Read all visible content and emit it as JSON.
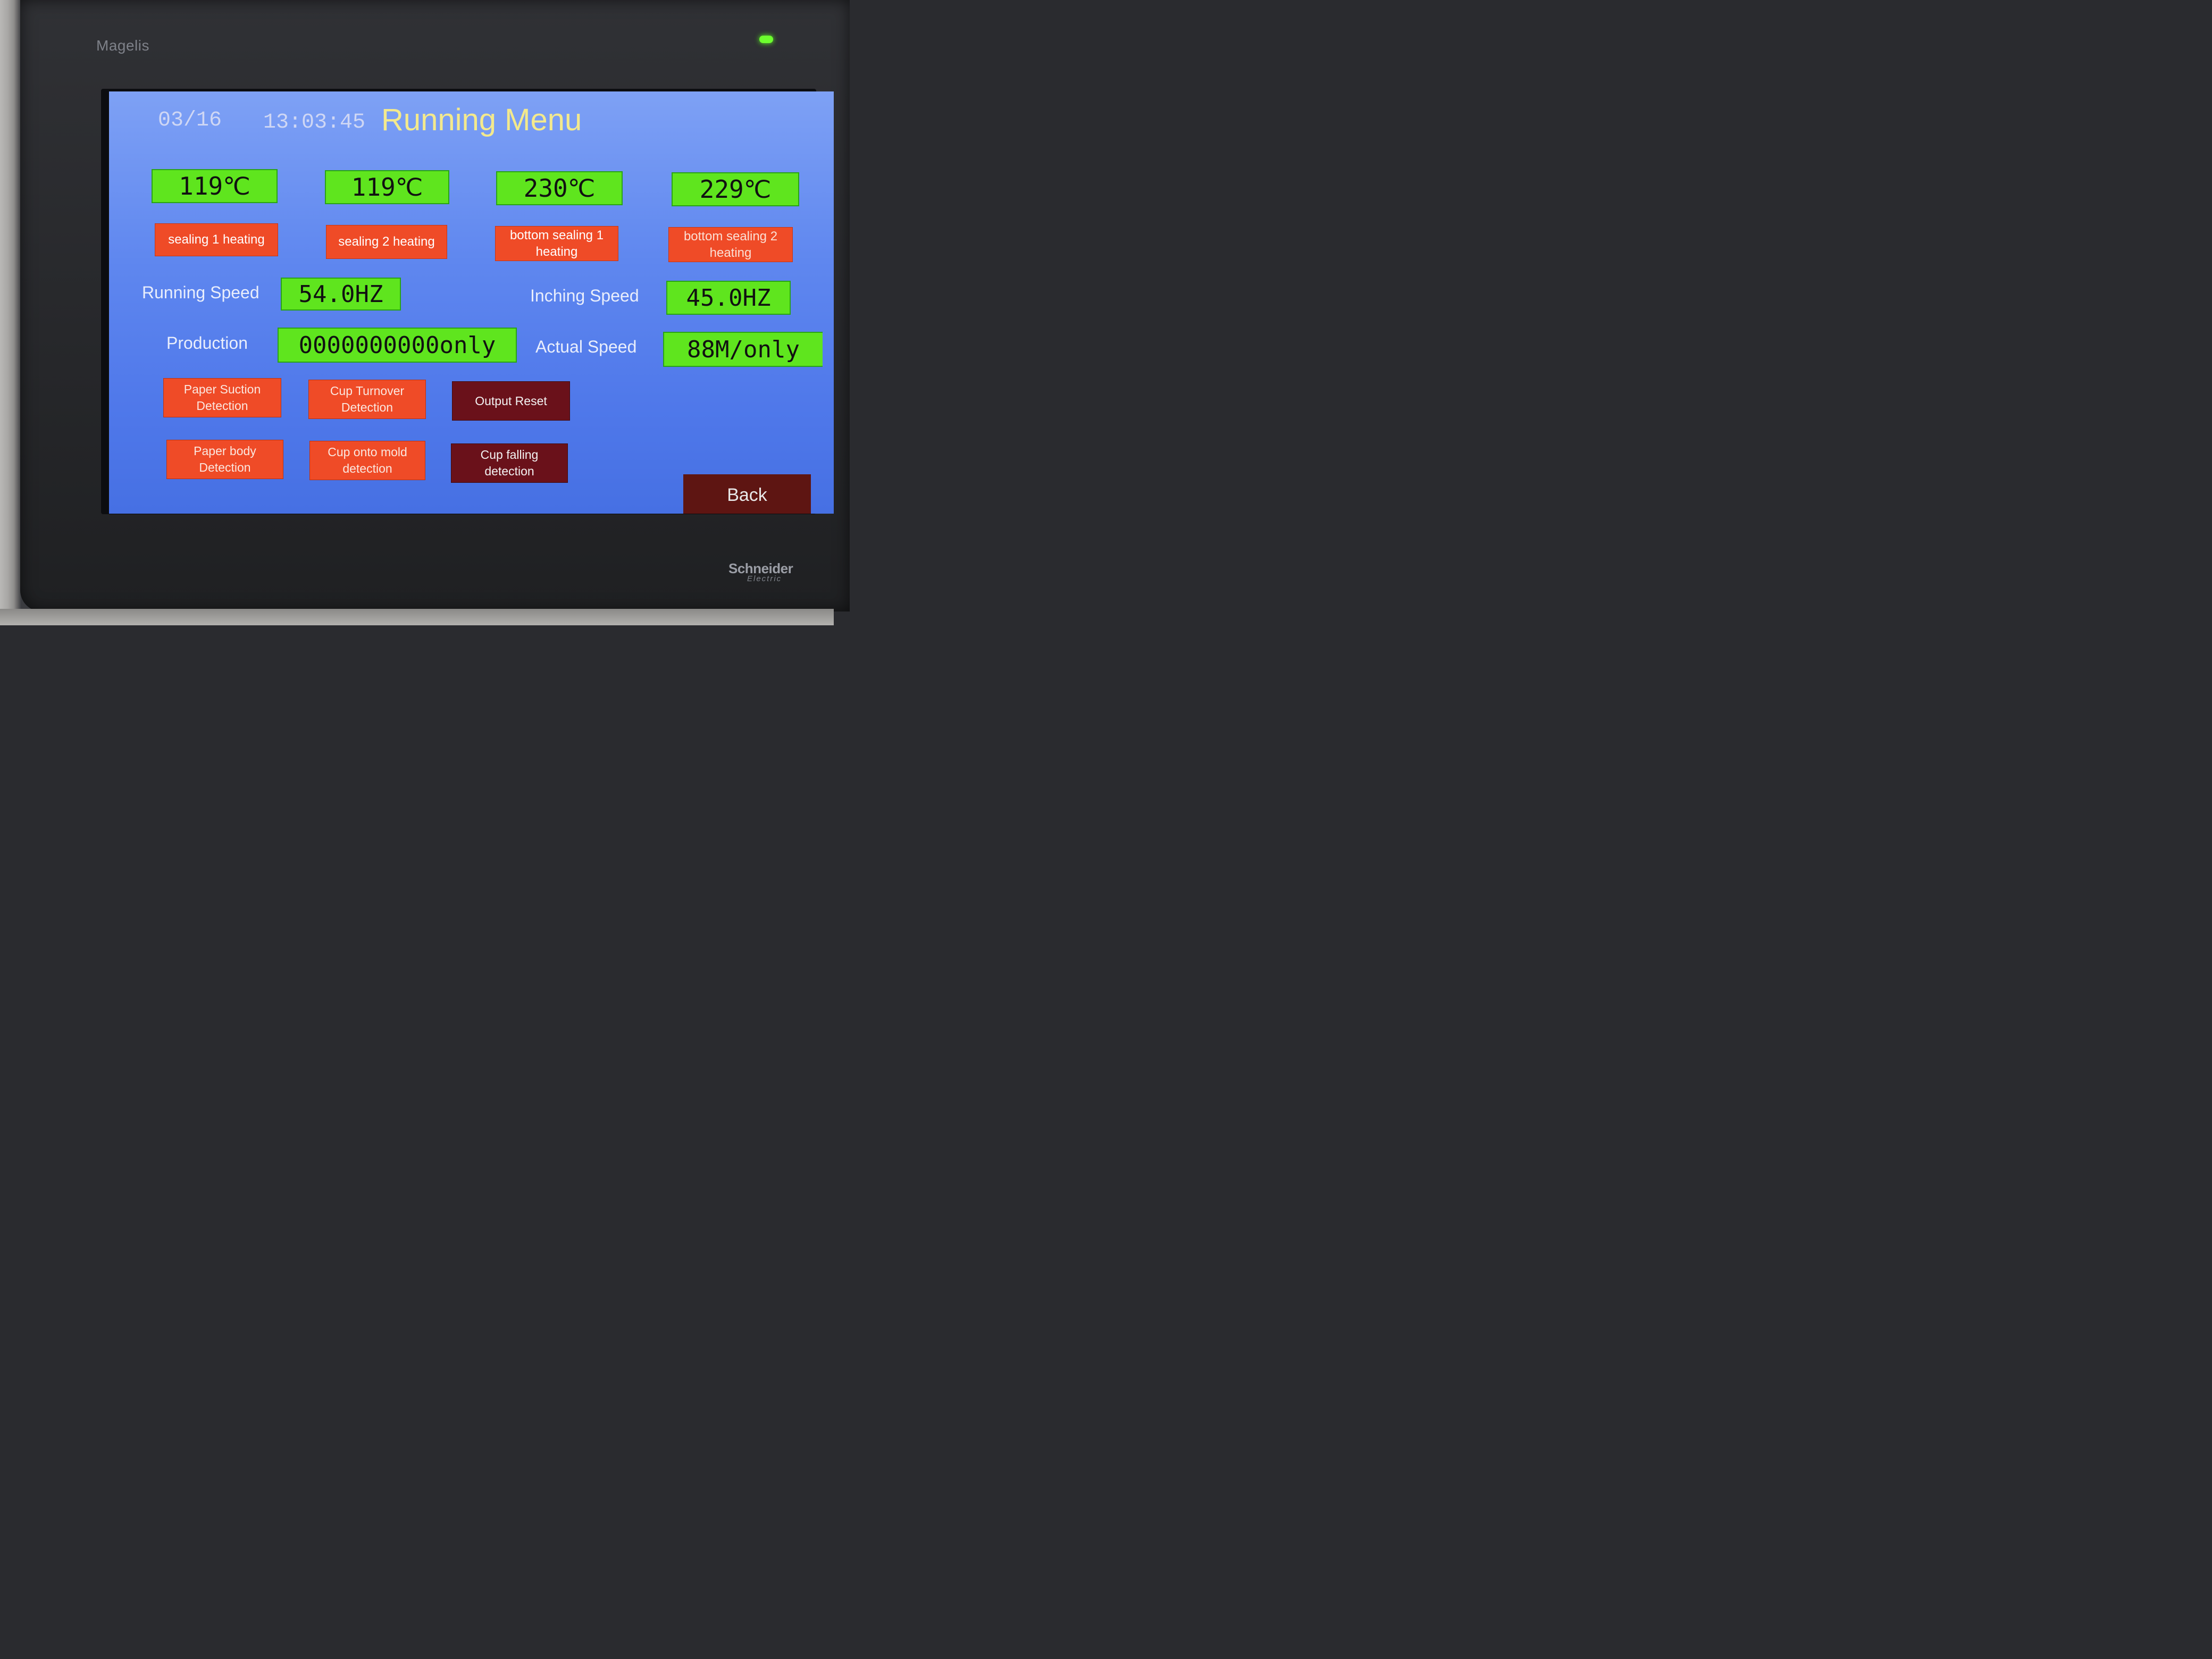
{
  "device": {
    "brand": "Magelis",
    "maker": "Schneider",
    "maker_sub": "Electric"
  },
  "header": {
    "date": "03/16",
    "time": "13:03:45",
    "title": "Running Menu"
  },
  "temperatures": [
    {
      "value": "119℃",
      "label": "sealing 1 heating"
    },
    {
      "value": "119℃",
      "label": "sealing 2 heating"
    },
    {
      "value": "230℃",
      "label": "bottom sealing 1 heating"
    },
    {
      "value": "229℃",
      "label": "bottom sealing 2 heating"
    }
  ],
  "speeds": {
    "running_label": "Running Speed",
    "running_value": "54.0HZ",
    "inching_label": "Inching Speed",
    "inching_value": "45.0HZ"
  },
  "production": {
    "label": "Production",
    "value": "0000000000only",
    "actual_label": "Actual Speed",
    "actual_value": "88M/only"
  },
  "buttons": {
    "paper_suction": "Paper Suction Detection",
    "cup_turnover": "Cup Turnover Detection",
    "output_reset": "Output Reset",
    "paper_body": "Paper body Detection",
    "cup_onto_mold": "Cup onto mold detection",
    "cup_falling": "Cup falling detection",
    "back": "Back"
  },
  "colors": {
    "screen_bg": "#5f87ef",
    "value_box": "#5fe51e",
    "status_red": "#ef4b27",
    "button_dark": "#6a111a",
    "title": "#f3e98d",
    "led": "#6dff2e"
  }
}
